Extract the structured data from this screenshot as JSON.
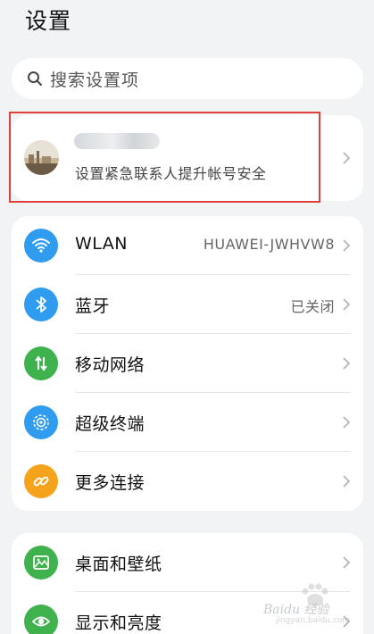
{
  "header": {
    "title": "设置"
  },
  "search": {
    "placeholder": "搜索设置项"
  },
  "account": {
    "subtitle": "设置紧急联系人提升帐号安全"
  },
  "connectivity": [
    {
      "id": "wlan",
      "label": "WLAN",
      "value": "HUAWEI-JWHVW8",
      "icon": "wifi-icon",
      "color": "#2f9cf0"
    },
    {
      "id": "bluetooth",
      "label": "蓝牙",
      "value": "已关闭",
      "icon": "bluetooth-icon",
      "color": "#2f9cf0"
    },
    {
      "id": "mobile-network",
      "label": "移动网络",
      "value": "",
      "icon": "mobile-data-icon",
      "color": "#3fb24d"
    },
    {
      "id": "super-device",
      "label": "超级终端",
      "value": "",
      "icon": "super-device-icon",
      "color": "#2f9cf0"
    },
    {
      "id": "more-connections",
      "label": "更多连接",
      "value": "",
      "icon": "link-icon",
      "color": "#f5a31a"
    }
  ],
  "display": [
    {
      "id": "wallpaper",
      "label": "桌面和壁纸",
      "value": "",
      "icon": "wallpaper-icon",
      "color": "#3fb24d"
    },
    {
      "id": "display-brightness",
      "label": "显示和亮度",
      "value": "",
      "icon": "eye-icon",
      "color": "#3fb24d"
    }
  ],
  "watermark": {
    "brand": "Baidu 经验",
    "url": "jingyan.baidu.com"
  }
}
